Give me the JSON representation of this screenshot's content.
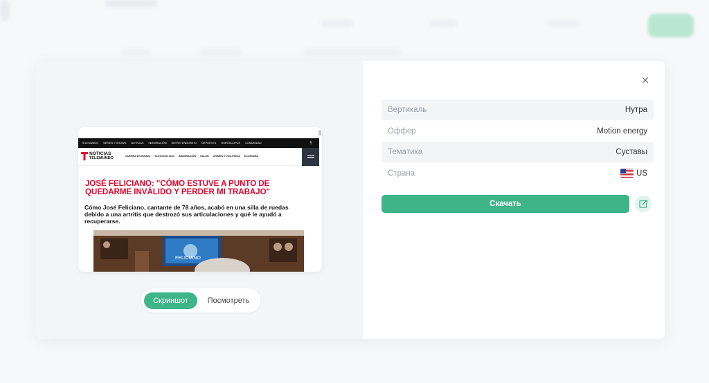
{
  "details": [
    {
      "label": "Вертикаль",
      "value": "Нутра"
    },
    {
      "label": "Оффер",
      "value": "Motion energy"
    },
    {
      "label": "Тематика",
      "value": "Суставы"
    },
    {
      "label": "Страна",
      "value": "US",
      "flag": "us-flag-icon"
    }
  ],
  "actions": {
    "download_label": "Скачать",
    "open_icon": "external-link-icon",
    "close_icon": "close-icon"
  },
  "preview": {
    "nav_items": [
      "TELEMUNDO",
      "SERIES Y SHOWS",
      "NOTICIAS",
      "INMIGRACIÓN",
      "ENTRETENIMIENTO",
      "DEPORTES",
      "HORÓSCOPOS",
      "COMUNIDAD"
    ],
    "brand_line1": "NOTICIAS",
    "brand_line2": "TELEMUNDO",
    "section_links": [
      "GUERRA EN ISRAEL",
      "ELECCIÓN 2024",
      "INMIGRACIÓN",
      "SALUD",
      "CRIMEN Y VIOLENCIA",
      "ECONOMÍA"
    ],
    "headline": "JOSÉ FELICIANO: \"CÓMO ESTUVE A PUNTO DE QUEDARME INVÁLIDO Y PERDER MI TRABAJO\"",
    "subheadline": "Cómo José Feliciano, cantante de 78 años, acabó en una silla de ruedas debido a una artritis que destrozó sus articulaciones y qué le ayudó a recuperarse.",
    "photo_caption": "FELICIANO"
  },
  "view_toggle": {
    "active": "Скриншот",
    "inactive": "Посмотреть"
  },
  "colors": {
    "accent": "#3eb489",
    "accent_soft": "#e2f4ec",
    "headline_red": "#e4002b"
  }
}
